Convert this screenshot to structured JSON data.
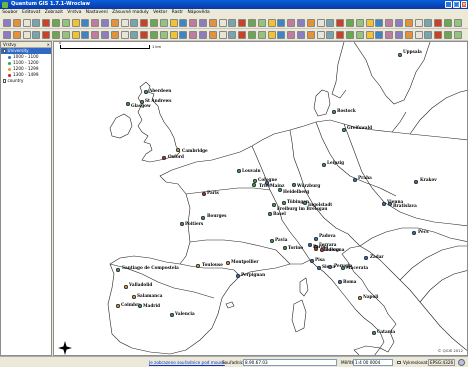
{
  "window": {
    "title": "Quantum GIS 1.7.1-Wroclaw"
  },
  "menu": [
    "Soubor",
    "Editovat",
    "Zobrazit",
    "Vrstva",
    "Nastavení",
    "Zásuvné moduly",
    "Vektor",
    "Rastr",
    "Nápověda"
  ],
  "legend": {
    "title": "Vrstvy",
    "layers": [
      {
        "name": "University",
        "selected": true,
        "checked": true
      },
      {
        "label": "1000 - 1100",
        "color": "#2e6fd8"
      },
      {
        "label": "1100 - 1200",
        "color": "#2fa84f"
      },
      {
        "label": "1200 - 1299",
        "color": "#e0a020"
      },
      {
        "label": "1300 - 1499",
        "color": "#d62020"
      },
      {
        "name": "country",
        "selected": false,
        "checked": true
      }
    ]
  },
  "scalebar": {
    "start": "0",
    "end": "1 km"
  },
  "colors": {
    "blue": "#2e6fd8",
    "green": "#2fa84f",
    "yellow": "#e0a020",
    "red": "#d62020",
    "purple": "#b040c0"
  },
  "cities": [
    {
      "name": "Uppsala",
      "c": "green"
    },
    {
      "name": "Aberdeen",
      "c": "green"
    },
    {
      "name": "St Andrews",
      "c": "green"
    },
    {
      "name": "Glasgow",
      "c": "green"
    },
    {
      "name": "Rostock",
      "c": "green"
    },
    {
      "name": "Greifswald",
      "c": "green"
    },
    {
      "name": "Cambridge",
      "c": "yellow"
    },
    {
      "name": "Oxford",
      "c": "red"
    },
    {
      "name": "Leipzig",
      "c": "green"
    },
    {
      "name": "Louvain",
      "c": "green"
    },
    {
      "name": "Cologne",
      "c": "green"
    },
    {
      "name": "Mainz",
      "c": "blue"
    },
    {
      "name": "Trier",
      "c": "green"
    },
    {
      "name": "Würzburg",
      "c": "green"
    },
    {
      "name": "Heidelberg",
      "c": "green"
    },
    {
      "name": "Praha",
      "c": "blue"
    },
    {
      "name": "Krakov",
      "c": "blue"
    },
    {
      "name": "Paris",
      "c": "red"
    },
    {
      "name": "Tübingen",
      "c": "green"
    },
    {
      "name": "Freiburg im Breisgau",
      "c": "green"
    },
    {
      "name": "Basel",
      "c": "green"
    },
    {
      "name": "Vienna",
      "c": "blue"
    },
    {
      "name": "Bratislava",
      "c": "blue"
    },
    {
      "name": "Ingolstadt",
      "c": "green"
    },
    {
      "name": "Bourges",
      "c": "green"
    },
    {
      "name": "Poitiers",
      "c": "green"
    },
    {
      "name": "Pavia",
      "c": "green"
    },
    {
      "name": "Padova",
      "c": "blue"
    },
    {
      "name": "Pécs",
      "c": "blue"
    },
    {
      "name": "Torino",
      "c": "green"
    },
    {
      "name": "Ferrara",
      "c": "green"
    },
    {
      "name": "Modena",
      "c": "red"
    },
    {
      "name": "Bologna",
      "c": "red"
    },
    {
      "name": "Parma",
      "c": "blue"
    },
    {
      "name": "Pisa",
      "c": "blue"
    },
    {
      "name": "Siena",
      "c": "blue"
    },
    {
      "name": "Perugia",
      "c": "blue"
    },
    {
      "name": "Macerata",
      "c": "green"
    },
    {
      "name": "Zadar",
      "c": "blue"
    },
    {
      "name": "Toulouse",
      "c": "yellow"
    },
    {
      "name": "Montpellier",
      "c": "yellow"
    },
    {
      "name": "Perpignan",
      "c": "blue"
    },
    {
      "name": "Santiago de Compostela",
      "c": "green"
    },
    {
      "name": "Valladolid",
      "c": "yellow"
    },
    {
      "name": "Salamanca",
      "c": "yellow"
    },
    {
      "name": "Coimbra",
      "c": "yellow"
    },
    {
      "name": "Madrid",
      "c": "green"
    },
    {
      "name": "Valencia",
      "c": "green"
    },
    {
      "name": "Roma",
      "c": "blue"
    },
    {
      "name": "Napoli",
      "c": "yellow"
    },
    {
      "name": "Catania",
      "c": "green"
    }
  ],
  "attribution": "© QGIS 2012",
  "statusbar": {
    "render_link": "Je zobrazeno souřadnice pod mouse",
    "coord_label": "Souřadnice:",
    "coord_value": "8.90.67.03",
    "scale_label": "Měřítko",
    "scale_value": "1:4 00 0004",
    "render_label": "Vykreslovat",
    "crs": "EPSG:4326"
  }
}
